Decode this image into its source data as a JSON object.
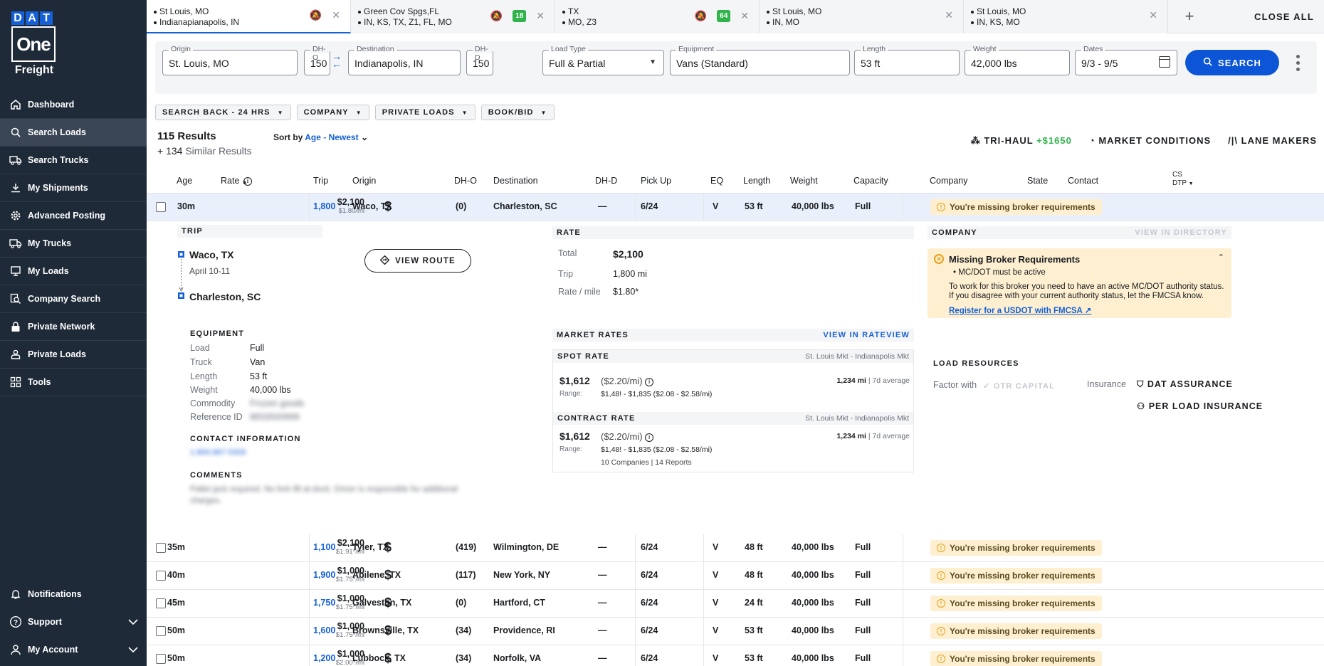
{
  "brand": {
    "dat_letters": [
      "D",
      "A",
      "T"
    ],
    "one": "One",
    "freight": "Freight",
    "colors": {
      "sidebar": "#1f2a38",
      "accent": "#1560d6",
      "warn_bg": "#fdefd0",
      "green": "#2fb34a"
    }
  },
  "nav": {
    "items": [
      {
        "label": "Dashboard",
        "icon": "home-icon"
      },
      {
        "label": "Search Loads",
        "icon": "search-icon",
        "active": true
      },
      {
        "label": "Search Trucks",
        "icon": "truck-icon"
      },
      {
        "label": "My Shipments",
        "icon": "download-icon"
      },
      {
        "label": "Advanced Posting",
        "icon": "gear-icon"
      },
      {
        "label": "My Trucks",
        "icon": "truck-icon"
      },
      {
        "label": "My Loads",
        "icon": "monitor-icon"
      },
      {
        "label": "Company Search",
        "icon": "magnify-doc-icon"
      },
      {
        "label": "Private Network",
        "icon": "lock-icon"
      },
      {
        "label": "Private Loads",
        "icon": "user-box-icon"
      },
      {
        "label": "Tools",
        "icon": "grid-icon"
      }
    ],
    "bottom": [
      {
        "label": "Notifications",
        "icon": "bell-icon"
      },
      {
        "label": "Support",
        "icon": "help-icon"
      },
      {
        "label": "My Account",
        "icon": "user-icon"
      }
    ]
  },
  "tabs": [
    {
      "line1": "St Louis, MO",
      "line2": "Indianapianapolis, IN",
      "badge": ""
    },
    {
      "line1": "Green Cov Spgs,FL",
      "line2": "IN, KS, TX, Z1, FL, MO",
      "badge": "18"
    },
    {
      "line1": "TX",
      "line2": "MO, Z3",
      "badge": "64"
    },
    {
      "line1": "St Louis, MO",
      "line2": "IN, MO",
      "badge": ""
    },
    {
      "line1": "St Louis, MO",
      "line2": "IN, KS, MO",
      "badge": ""
    }
  ],
  "tabs_add": "+",
  "close_all": "CLOSE ALL",
  "search": {
    "origin_label": "Origin",
    "origin": "St. Louis, MO",
    "dho_label": "DH-O",
    "dho": "150",
    "dest_label": "Destination",
    "dest": "Indianapolis, IN",
    "dhd_label": "DH-D",
    "dhd": "150",
    "loadtype_label": "Load Type",
    "loadtype": "Full & Partial",
    "equip_label": "Equipment",
    "equip": "Vans (Standard)",
    "length_label": "Length",
    "length": "53 ft",
    "weight_label": "Weight",
    "weight": "42,000 lbs",
    "dates_label": "Dates",
    "dates": "9/3 - 9/5",
    "button": "SEARCH"
  },
  "filters": [
    "SEARCH BACK - 24 HRS",
    "COMPANY",
    "PRIVATE LOADS",
    "BOOK/BID"
  ],
  "results": {
    "count": "115 Results",
    "similar_n": "+ 134",
    "similar": "Similar Results",
    "sort_by": "Sort by",
    "sort_value": "Age - Newest"
  },
  "right_tools": {
    "trihaul": "TRI-HAUL",
    "trihaul_amt": "+$1650",
    "market": "MARKET CONDITIONS",
    "lane": "LANE MAKERS"
  },
  "columns": {
    "age": "Age",
    "rate": "Rate",
    "trip": "Trip",
    "origin": "Origin",
    "dho": "DH-O",
    "destination": "Destination",
    "dhd": "DH-D",
    "pickup": "Pick Up",
    "eq": "EQ",
    "length": "Length",
    "weight": "Weight",
    "capacity": "Capacity",
    "company": "Company",
    "state": "State",
    "contact": "Contact",
    "cs": "CS",
    "dtp": "DTP"
  },
  "rows": [
    {
      "age": "30m",
      "rate": "$2,100",
      "rpm": "$1.80/mi",
      "trip": "1,800",
      "origin": "Waco, TX",
      "dho": "(0)",
      "dest": "Charleston, SC",
      "dhd": "—",
      "pickup": "6/24",
      "eq": "V",
      "length": "53 ft",
      "weight": "40,000 lbs",
      "capacity": "Full",
      "company": "You're missing broker requirements"
    },
    {
      "age": "35m",
      "rate": "$2,100",
      "rpm": "$1.91*/mi",
      "trip": "1,100",
      "origin": "Tyler, TX",
      "dho": "(419)",
      "dest": "Wilmington, DE",
      "dhd": "—",
      "pickup": "6/24",
      "eq": "V",
      "length": "48 ft",
      "weight": "40,000 lbs",
      "capacity": "Full",
      "company": "You're missing broker requirements"
    },
    {
      "age": "40m",
      "rate": "$1,000",
      "rpm": "$1.75*/mi",
      "trip": "1,900",
      "origin": "Abilene, TX",
      "dho": "(117)",
      "dest": "New York, NY",
      "dhd": "—",
      "pickup": "6/24",
      "eq": "V",
      "length": "48 ft",
      "weight": "40,000 lbs",
      "capacity": "Full",
      "company": "You're missing broker requirements"
    },
    {
      "age": "45m",
      "rate": "$1,000",
      "rpm": "$1.75*/mi",
      "trip": "1,750",
      "origin": "Galveston, TX",
      "dho": "(0)",
      "dest": "Hartford, CT",
      "dhd": "—",
      "pickup": "6/24",
      "eq": "V",
      "length": "24 ft",
      "weight": "40,000 lbs",
      "capacity": "Full",
      "company": "You're missing broker requirements"
    },
    {
      "age": "50m",
      "rate": "$1,000",
      "rpm": "$1.75*/mi",
      "trip": "1,600",
      "origin": "Brownsville, TX",
      "dho": "(34)",
      "dest": "Providence, RI",
      "dhd": "—",
      "pickup": "6/24",
      "eq": "V",
      "length": "53 ft",
      "weight": "40,000 lbs",
      "capacity": "Full",
      "company": "You're missing broker requirements"
    },
    {
      "age": "50m",
      "rate": "$1,000",
      "rpm": "$2.00*/mi",
      "trip": "1,200",
      "origin": "Lubbock, TX",
      "dho": "(34)",
      "dest": "Norfolk, VA",
      "dhd": "—",
      "pickup": "6/24",
      "eq": "V",
      "length": "53 ft",
      "weight": "40,000 lbs",
      "capacity": "Full",
      "company": "You're missing broker requirements"
    }
  ],
  "detail": {
    "trip_title": "TRIP",
    "origin": "Waco, TX",
    "dates": "April 10-11",
    "dest": "Charleston, SC",
    "view_route": "VIEW ROUTE",
    "equip_title": "EQUIPMENT",
    "equip": [
      {
        "k": "Load",
        "v": "Full"
      },
      {
        "k": "Truck",
        "v": "Van"
      },
      {
        "k": "Length",
        "v": "53 ft"
      },
      {
        "k": "Weight",
        "v": "40,000 lbs"
      },
      {
        "k": "Commodity",
        "v": "Frozen goods"
      },
      {
        "k": "Reference ID",
        "v": "8833500999"
      }
    ],
    "contact_title": "CONTACT INFORMATION",
    "contact": "1-800-867-5309",
    "comments_title": "COMMENTS",
    "comments": "Pallet jack required. No fork lift at dock. Driver is responsible for additional charges.",
    "rate_title": "RATE",
    "rate": [
      {
        "k": "Total",
        "v": "$2,100"
      },
      {
        "k": "Trip",
        "v": "1,800 mi"
      },
      {
        "k": "Rate / mile",
        "v": "$1.80*"
      }
    ],
    "market_title": "MARKET RATES",
    "market_link": "VIEW IN RATEVIEW",
    "spot": {
      "title": "SPOT RATE",
      "lane": "St. Louis Mkt - Indianapolis Mkt",
      "rate": "$1,612",
      "per": "($2.20/mi)",
      "miles": "1,234 mi",
      "avg": "| 7d average",
      "range_label": "Range:",
      "range": "$1,48! - $1,835  ($2.08 - $2.58/mi)"
    },
    "contract": {
      "title": "CONTRACT RATE",
      "lane": "St. Louis Mkt - Indianapolis Mkt",
      "rate": "$1,612",
      "per": "($2.20/mi)",
      "miles": "1,234 mi",
      "avg": "| 7d average",
      "range_label": "Range:",
      "range": "$1,48! - $1,835  ($2.08 - $2.58/mi)",
      "reports": "10 Companies | 14 Reports"
    },
    "company_title": "COMPANY",
    "company_link": "VIEW IN DIRECTORY",
    "broker": {
      "title": "Missing Broker Requirements",
      "bullet": "MC/DOT must be active",
      "p1": "To work for this broker you need to have an active MC/DOT authority status.",
      "p2": "If you disagree with your current authority status, let the FMCSA know.",
      "link": "Register for a USDOT with FMCSA"
    },
    "resources_title": "LOAD RESOURCES",
    "factor_label": "Factor with",
    "factor": "OTR CAPITAL",
    "insurance_label": "Insurance",
    "assurance": "DAT ASSURANCE",
    "per_load": "PER LOAD INSURANCE"
  }
}
